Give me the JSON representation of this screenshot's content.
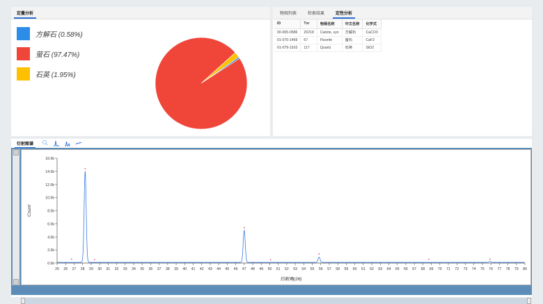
{
  "left_panel": {
    "tab_label": "定量分析",
    "legend": [
      {
        "label": "方解石 (0.58%)",
        "color": "#2b8de8"
      },
      {
        "label": "萤石 (97.47%)",
        "color": "#f0463a"
      },
      {
        "label": "石英 (1.95%)",
        "color": "#ffc000"
      }
    ]
  },
  "right_panel": {
    "tabs": [
      {
        "label": "物相列表",
        "active": false
      },
      {
        "label": "检索结果",
        "active": false
      },
      {
        "label": "定性分析",
        "active": true
      }
    ],
    "columns": [
      "ID",
      "Txr",
      "物相名称",
      "中文名称",
      "化学式"
    ],
    "rows": [
      [
        "00-005-0586",
        "20218",
        "Calcite, syn",
        "方解石",
        "CaCO3"
      ],
      [
        "01-070-1469",
        "67",
        "Fluorite",
        "萤石",
        "CaF2"
      ],
      [
        "01-079-1910",
        "117",
        "Quartz",
        "石英",
        "SiO2"
      ]
    ]
  },
  "bottom_panel": {
    "tab_label": "衍射图谱",
    "tool_icons": [
      "zoom-icon",
      "peak-icon",
      "peak-label-icon",
      "fit-icon"
    ]
  },
  "chart_data": [
    {
      "type": "pie",
      "slices": [
        {
          "label": "方解石",
          "value": 0.58,
          "color": "#2b8de8"
        },
        {
          "label": "萤石",
          "value": 97.47,
          "color": "#f0463a"
        },
        {
          "label": "石英",
          "value": 1.95,
          "color": "#ffc000"
        }
      ]
    },
    {
      "type": "line",
      "xlabel": "衍射角(2θ)",
      "ylabel": "Count",
      "xlim": [
        25,
        80
      ],
      "ylim": [
        0,
        16000
      ],
      "y_ticks": [
        0,
        2000,
        4000,
        6000,
        8000,
        10000,
        12000,
        14000,
        16000
      ],
      "y_tick_labels": [
        "0.0k",
        "2.0k",
        "4.0k",
        "6.0k",
        "8.0k",
        "10.0k",
        "12.0k",
        "14.0k",
        "16.0k"
      ],
      "x_ticks": [
        25,
        26,
        27,
        28,
        29,
        30,
        31,
        32,
        33,
        34,
        35,
        36,
        37,
        38,
        39,
        40,
        41,
        42,
        43,
        44,
        45,
        46,
        47,
        48,
        49,
        50,
        51,
        52,
        53,
        54,
        55,
        56,
        57,
        58,
        59,
        60,
        61,
        62,
        63,
        64,
        65,
        66,
        67,
        68,
        69,
        70,
        71,
        72,
        73,
        74,
        75,
        76,
        77,
        78,
        79,
        80
      ],
      "line_color": "#3a7be0",
      "series": [
        {
          "peaks": [
            {
              "x": 28.3,
              "y": 14000
            },
            {
              "x": 47.0,
              "y": 5000
            },
            {
              "x": 55.8,
              "y": 900
            },
            {
              "x": 75.9,
              "y": 250
            }
          ],
          "baseline": 100
        }
      ],
      "markers": [
        {
          "x": 26.7,
          "y": 600
        },
        {
          "x": 28.3,
          "y": 14400
        },
        {
          "x": 29.4,
          "y": 500
        },
        {
          "x": 47.0,
          "y": 5400
        },
        {
          "x": 50.1,
          "y": 500
        },
        {
          "x": 55.8,
          "y": 1400
        },
        {
          "x": 68.7,
          "y": 600
        },
        {
          "x": 75.9,
          "y": 600
        }
      ],
      "marker_color": "#e64b9a"
    }
  ]
}
